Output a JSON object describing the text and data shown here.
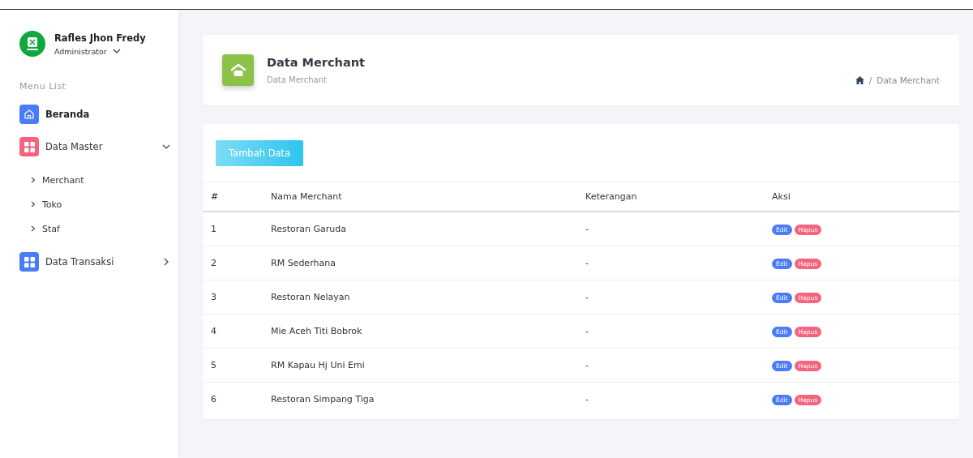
{
  "user": {
    "name": "Rafles Jhon Fredy",
    "role": "Administrator"
  },
  "sidebar": {
    "heading": "Menu List",
    "items": [
      {
        "label": "Beranda",
        "kind": "link",
        "color": "#4a7cf7",
        "selected": true
      },
      {
        "label": "Data Master",
        "kind": "group",
        "color": "#f4647e",
        "selected": false,
        "expanded": true,
        "children": [
          {
            "label": "Merchant"
          },
          {
            "label": "Toko"
          },
          {
            "label": "Staf"
          }
        ]
      },
      {
        "label": "Data Transaksi",
        "kind": "group",
        "color": "#4a7cf7",
        "selected": false,
        "expanded": false
      }
    ]
  },
  "header": {
    "title": "Data Merchant",
    "subtitle": "Data Merchant",
    "breadcrumb": {
      "separator": "/",
      "items": [
        "Data Merchant"
      ]
    }
  },
  "add_button": "Tambah Data",
  "table": {
    "columns": [
      "#",
      "Nama Merchant",
      "Keterangan",
      "Aksi"
    ],
    "rows": [
      {
        "no": "1",
        "name": "Restoran Garuda",
        "note": "-",
        "actions": [
          "Edit",
          "Hapus"
        ]
      },
      {
        "no": "2",
        "name": "RM Sederhana",
        "note": "-",
        "actions": [
          "Edit",
          "Hapus"
        ]
      },
      {
        "no": "3",
        "name": "Restoran Nelayan",
        "note": "-",
        "actions": [
          "Edit",
          "Hapus"
        ]
      },
      {
        "no": "4",
        "name": "Mie Aceh Titi Bobrok",
        "note": "-",
        "actions": [
          "Edit",
          "Hapus"
        ]
      },
      {
        "no": "5",
        "name": "RM Kapau Hj Uni Emi",
        "note": "-",
        "actions": [
          "Edit",
          "Hapus"
        ]
      },
      {
        "no": "6",
        "name": "Restoran Simpang Tiga",
        "note": "-",
        "actions": [
          "Edit",
          "Hapus"
        ]
      }
    ]
  }
}
